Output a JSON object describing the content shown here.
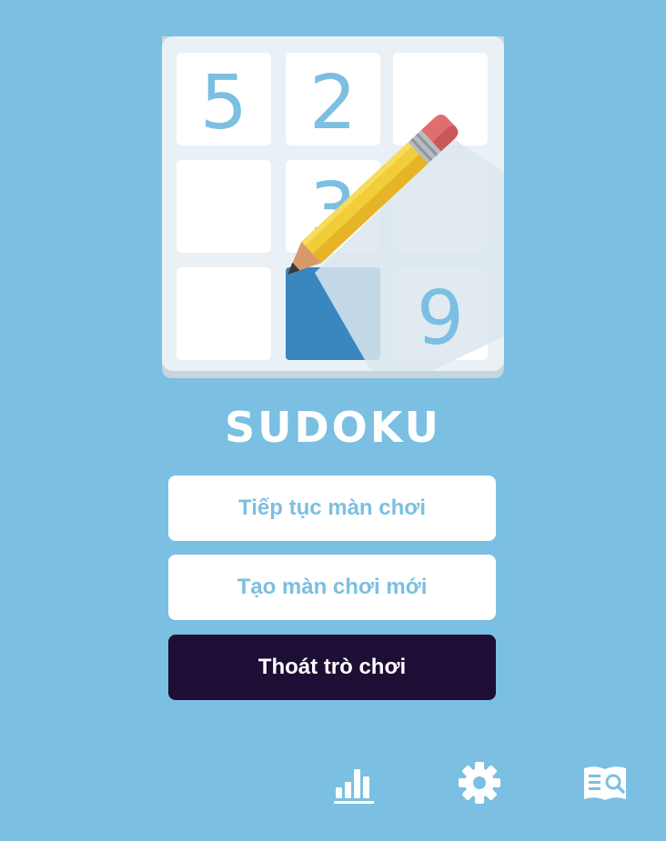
{
  "app": {
    "title": "SUDOKU"
  },
  "logo": {
    "icon": "sudoku-pencil-logo",
    "digits": [
      "5",
      "2",
      "3",
      "9"
    ]
  },
  "menu": {
    "continue_label": "Tiếp tục màn chơi",
    "new_game_label": "Tạo màn chơi mới",
    "exit_label": "Thoát trò chơi"
  },
  "bottom_bar": {
    "icons": [
      "stats-icon",
      "settings-icon",
      "guide-icon"
    ]
  },
  "colors": {
    "background": "#7bbfe2",
    "button_light": "#ffffff",
    "button_dark": "#1e0e36",
    "accent_blue": "#3a87c0"
  }
}
